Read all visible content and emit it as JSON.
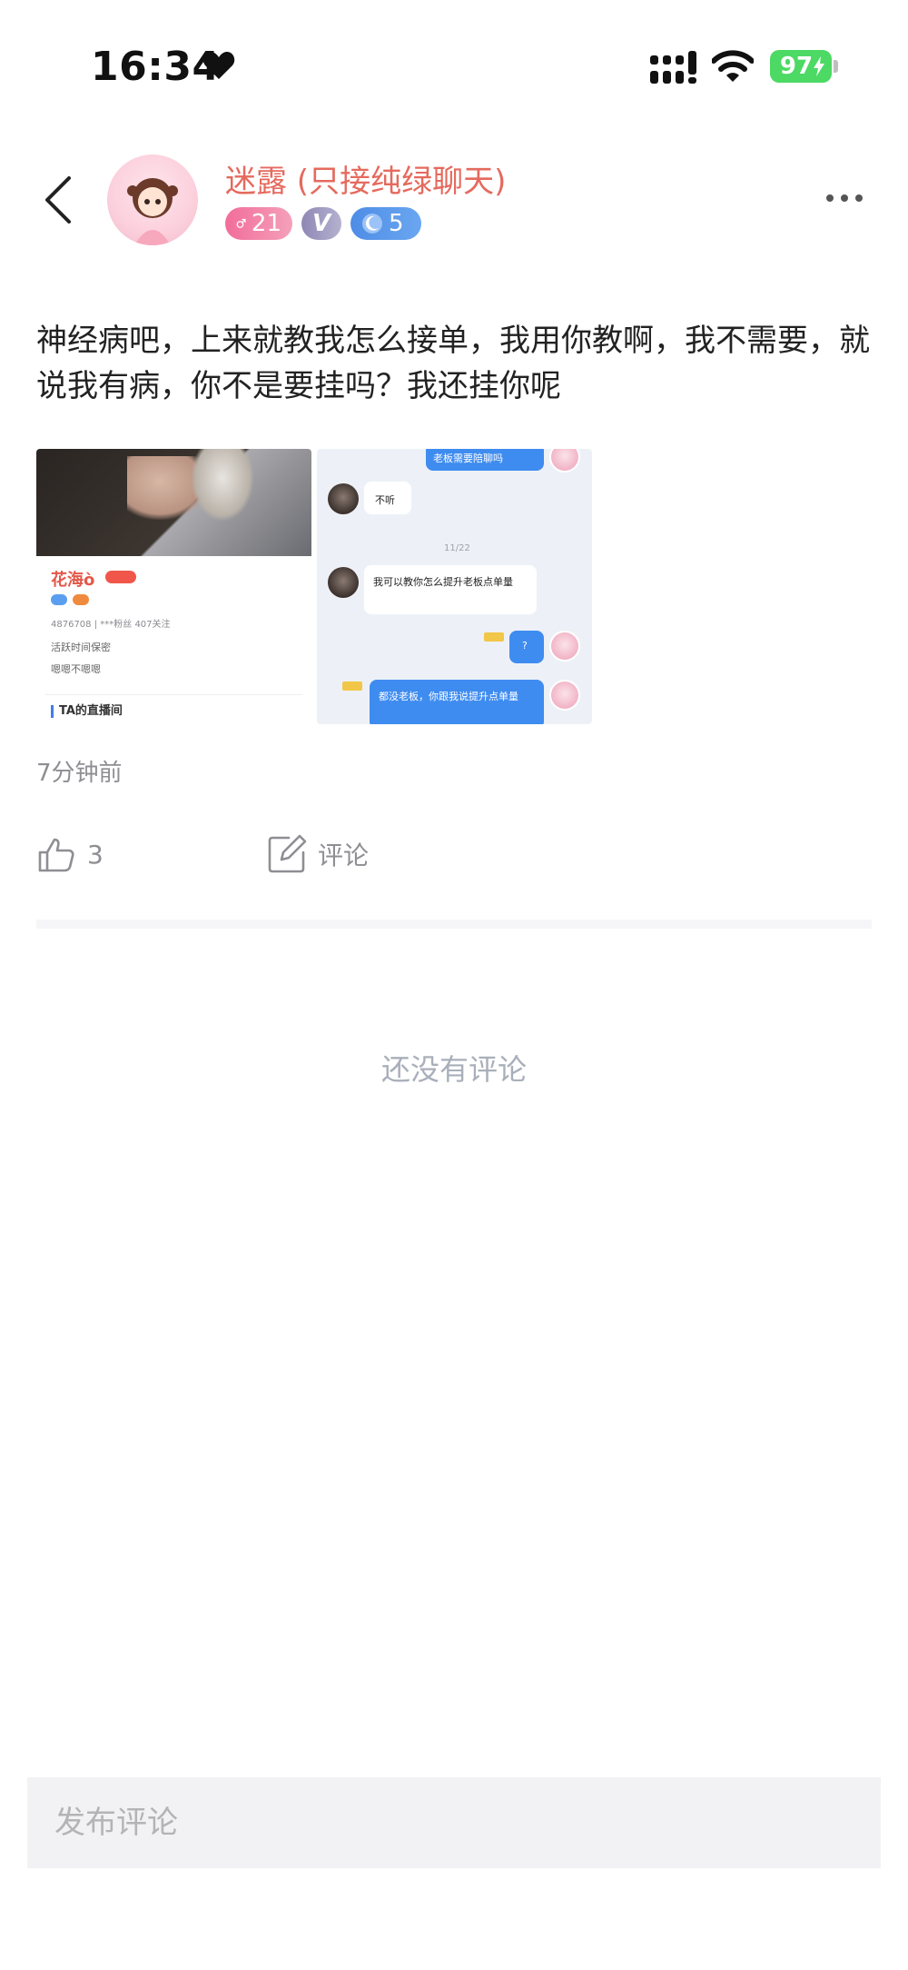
{
  "status_bar": {
    "time": "16:34",
    "battery_level": "97",
    "icons": [
      "heart-icon",
      "signal-icon",
      "wifi-icon",
      "battery-icon"
    ]
  },
  "header": {
    "username": "迷露 (只接纯绿聊天)",
    "username_color": "#e56a5e",
    "badges": {
      "gender_age": "21",
      "vip_symbol": "V",
      "level": "5"
    },
    "icons": [
      "back-arrow-icon",
      "more-dots-icon"
    ]
  },
  "post": {
    "text": "神经病吧，上来就教我怎么接单，我用你教啊，我不需要，就说我有病，你不是要挂吗？我还挂你呢",
    "time": "7分钟前",
    "likes": "3",
    "comment_label": "评论"
  },
  "image1": {
    "profile_name": "花海ò",
    "stats": "4876708 | ***粉丝 407关注",
    "line1": "活跃时间保密",
    "line2": "嗯嗯不嗯嗯",
    "live_label": "TA的直播间"
  },
  "image2": {
    "msg_top": "老板需要陪聊吗",
    "msg_1": "不听",
    "date": "11/22",
    "msg_2": "我可以教你怎么提升老板点单量",
    "msg_3": "?",
    "msg_4": "都没老板，你跟我说提升点单量"
  },
  "comments": {
    "empty_text": "还没有评论",
    "input_placeholder": "发布评论"
  },
  "colors": {
    "accent_blue": "#4e8de6",
    "gender_pink": "#f26d9a",
    "battery_green": "#4cd964"
  }
}
